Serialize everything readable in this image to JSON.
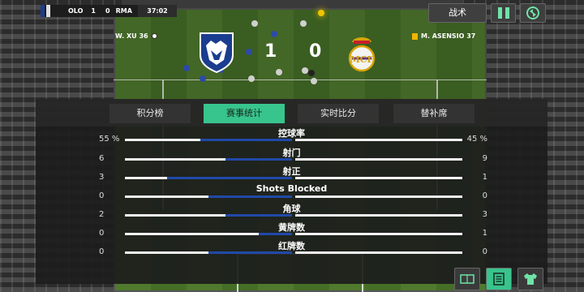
{
  "scoreboard": {
    "home_abbr": "OLO",
    "home_score": "1",
    "away_score": "0",
    "away_abbr": "RMA",
    "time": "37:02"
  },
  "toolbar": {
    "tactics_label": "战术"
  },
  "match": {
    "home_scorer": "W. XU 36",
    "away_event": "M. ASENSIO 37",
    "home_score": "1",
    "away_score": "0",
    "home_color": "#1b3d8f",
    "away_color": "#e0e0e0"
  },
  "tabs": [
    {
      "label": "积分榜",
      "active": false
    },
    {
      "label": "赛事统计",
      "active": true
    },
    {
      "label": "实时比分",
      "active": false
    },
    {
      "label": "替补席",
      "active": false
    }
  ],
  "stats": [
    {
      "label": "控球率",
      "home": "55 %",
      "away": "45 %",
      "home_frac": 0.55,
      "away_frac": 0.45
    },
    {
      "label": "射门",
      "home": "6",
      "away": "9",
      "home_frac": 0.4,
      "away_frac": 0.6
    },
    {
      "label": "射正",
      "home": "3",
      "away": "1",
      "home_frac": 0.75,
      "away_frac": 0.25
    },
    {
      "label": "Shots Blocked",
      "home": "0",
      "away": "0",
      "home_frac": 0.5,
      "away_frac": 0.5
    },
    {
      "label": "角球",
      "home": "2",
      "away": "3",
      "home_frac": 0.4,
      "away_frac": 0.6
    },
    {
      "label": "黄牌数",
      "home": "0",
      "away": "1",
      "home_frac": 0.2,
      "away_frac": 0.8
    },
    {
      "label": "红牌数",
      "home": "0",
      "away": "0",
      "home_frac": 0.5,
      "away_frac": 0.5
    }
  ],
  "icons": {
    "pause": "pause-icon",
    "substitution": "substitution-icon",
    "formation": "formation-icon",
    "stats": "stats-icon",
    "kit": "kit-icon"
  },
  "colors": {
    "accent": "#38c48d",
    "home_bar": "#2149a8",
    "away_bar": "#f2f2f2"
  }
}
